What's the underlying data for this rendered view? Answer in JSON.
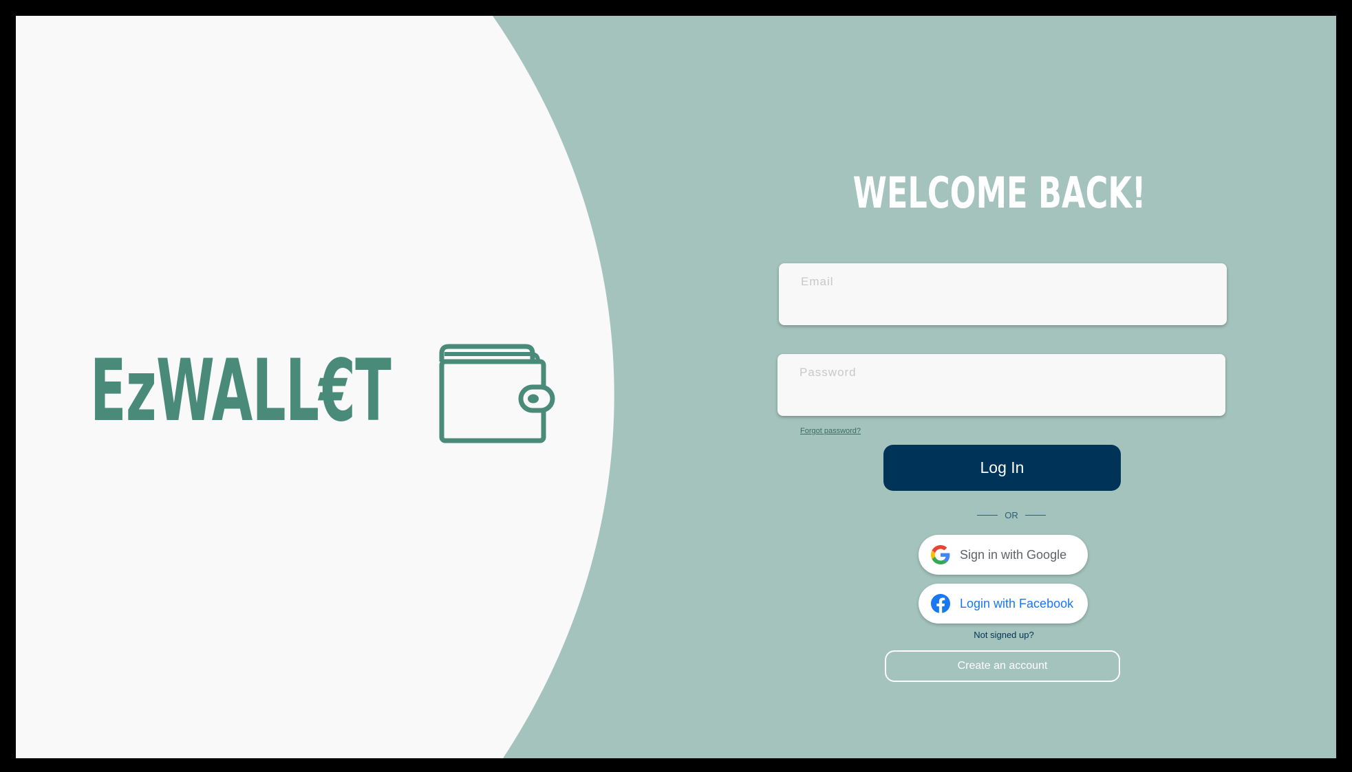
{
  "brand": {
    "logo_text": "EzWALL€T",
    "primary_color": "#4a8a78",
    "panel_color": "#a4c3bc",
    "left_bg_color": "#f9f9f9"
  },
  "form": {
    "title": "WELCOME BACK!",
    "email_placeholder": "Email",
    "password_placeholder": "Password",
    "forgot_link": "Forgot password?",
    "login_label": "Log In",
    "login_color": "#003358",
    "or_text": "OR",
    "google_label": "Sign in with Google",
    "facebook_label": "Login with Facebook",
    "not_signed_text": "Not signed up?",
    "create_account_label": "Create an account"
  },
  "icons": {
    "logo": "wallet-icon",
    "google": "google-icon",
    "facebook": "facebook-icon"
  }
}
